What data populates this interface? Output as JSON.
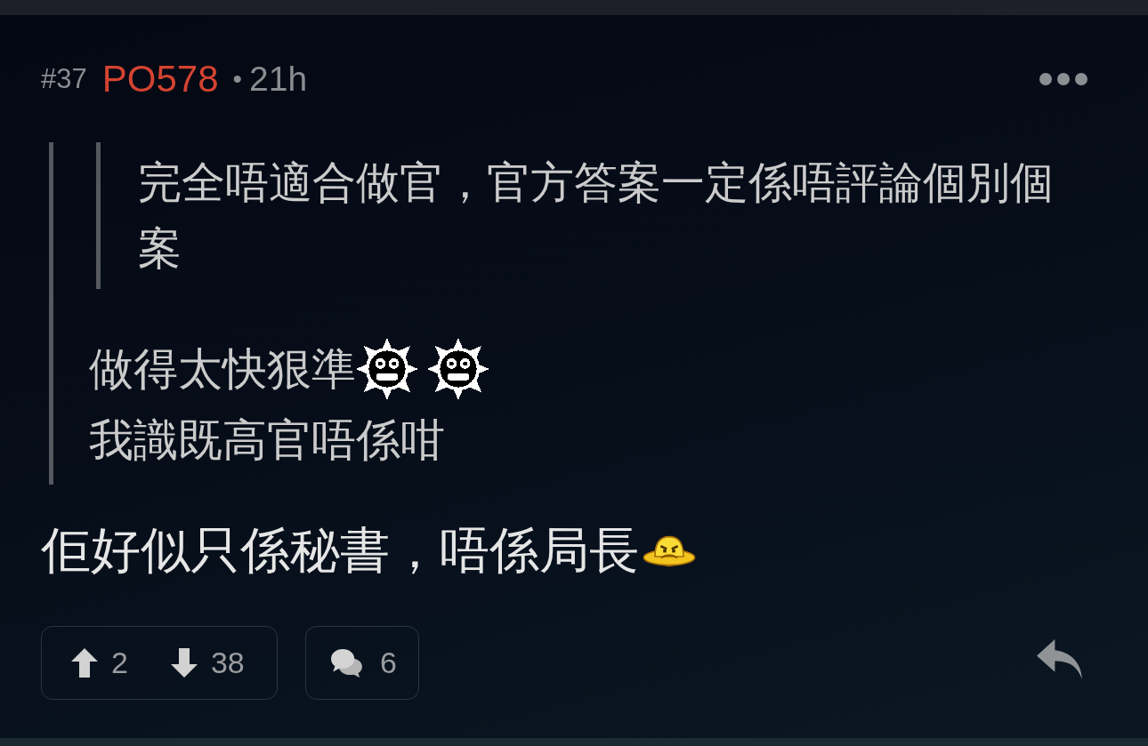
{
  "post": {
    "number": "#37",
    "author": "PO578",
    "separator": "•",
    "time": "21h",
    "quote": {
      "quote": {
        "text": "完全唔適合做官，官方答案一定係唔評論個別個案"
      },
      "lines": [
        {
          "parts": [
            {
              "kind": "text",
              "text": "做得太快狠準"
            },
            {
              "kind": "spikyface"
            },
            {
              "kind": "spikyface"
            }
          ]
        },
        {
          "parts": [
            {
              "kind": "text",
              "text": "我識既高官唔係咁"
            }
          ]
        }
      ]
    },
    "body": {
      "lines": [
        {
          "parts": [
            {
              "kind": "text",
              "text": "佢好似只係秘書，唔係局長"
            },
            {
              "kind": "saucerface"
            }
          ]
        }
      ]
    },
    "actions": {
      "upvotes": "2",
      "downvotes": "38",
      "comments": "6"
    }
  }
}
